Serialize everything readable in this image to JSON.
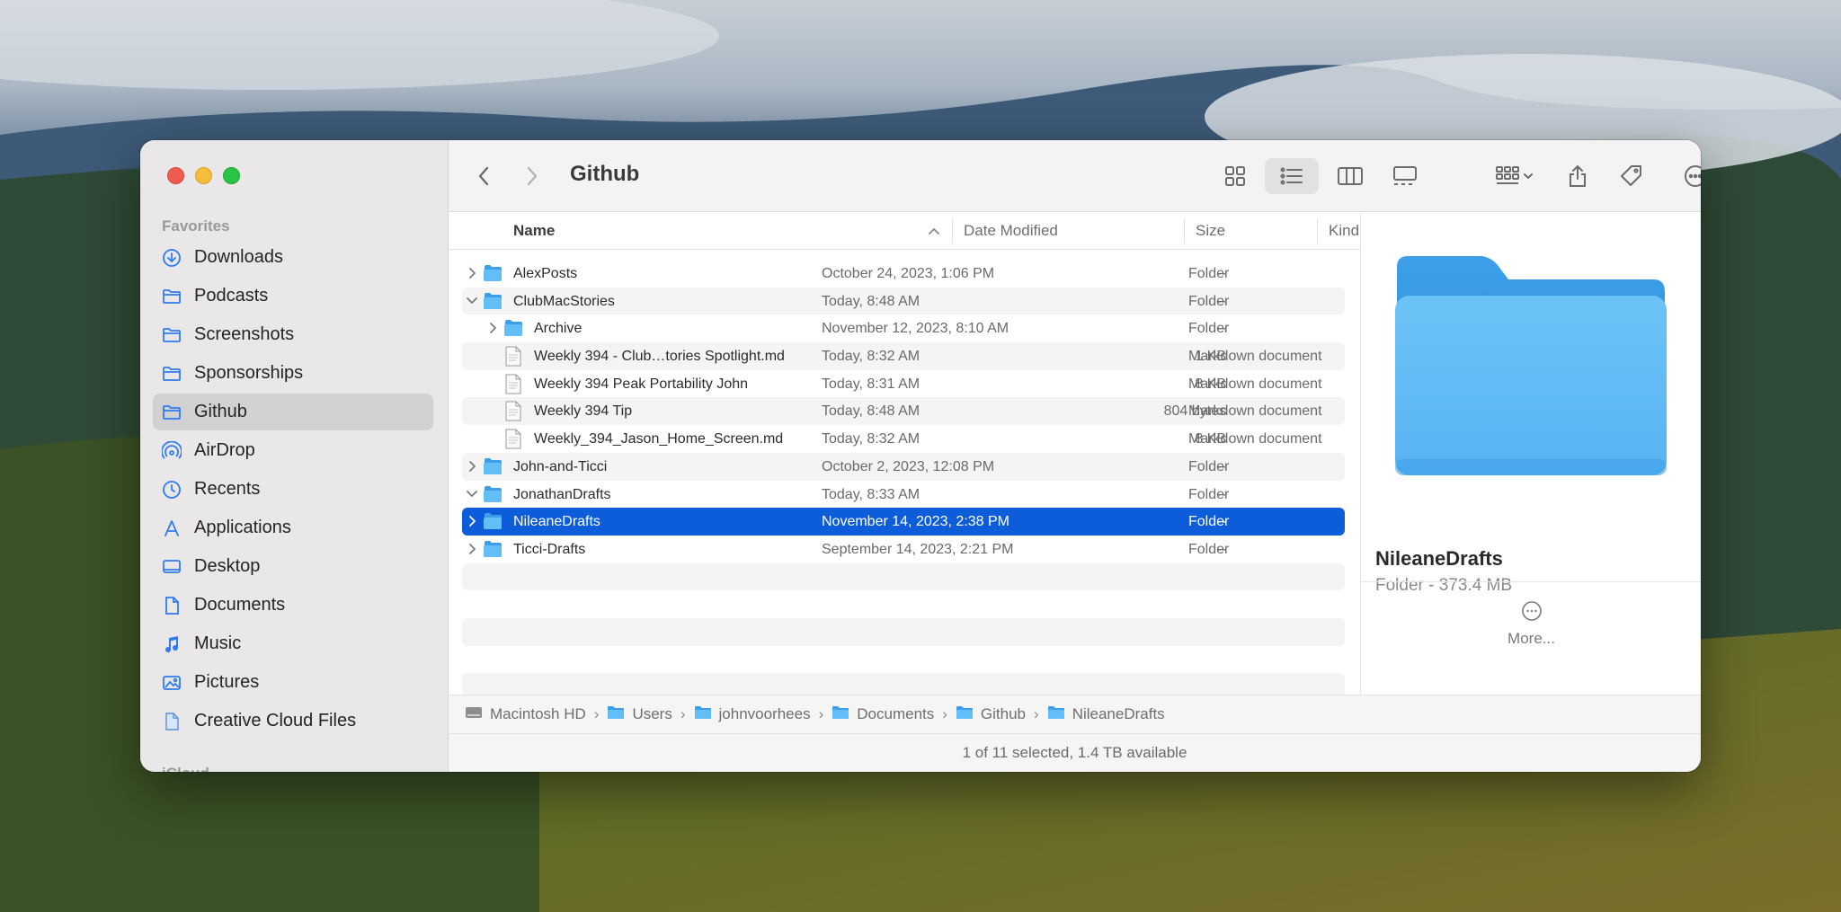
{
  "window": {
    "title": "Github"
  },
  "sidebar": {
    "section_favorites": "Favorites",
    "section_icloud": "iCloud",
    "items": [
      {
        "label": "Downloads",
        "icon": "download-icon",
        "active": false
      },
      {
        "label": "Podcasts",
        "icon": "folder-icon",
        "active": false
      },
      {
        "label": "Screenshots",
        "icon": "folder-icon",
        "active": false
      },
      {
        "label": "Sponsorships",
        "icon": "folder-icon",
        "active": false
      },
      {
        "label": "Github",
        "icon": "folder-icon",
        "active": true
      },
      {
        "label": "AirDrop",
        "icon": "airdrop-icon",
        "active": false
      },
      {
        "label": "Recents",
        "icon": "clock-icon",
        "active": false
      },
      {
        "label": "Applications",
        "icon": "applications-icon",
        "active": false
      },
      {
        "label": "Desktop",
        "icon": "desktop-icon",
        "active": false
      },
      {
        "label": "Documents",
        "icon": "document-icon",
        "active": false
      },
      {
        "label": "Music",
        "icon": "music-icon",
        "active": false
      },
      {
        "label": "Pictures",
        "icon": "pictures-icon",
        "active": false
      },
      {
        "label": "Creative Cloud Files",
        "icon": "file-icon",
        "active": false
      }
    ]
  },
  "columns": {
    "name": "Name",
    "date": "Date Modified",
    "size": "Size",
    "kind": "Kind"
  },
  "files": [
    {
      "name": "AlexPosts",
      "date": "October 24, 2023, 1:06 PM",
      "size": "--",
      "kind": "Folder",
      "type": "folder",
      "depth": 0,
      "expanded": false,
      "selected": false
    },
    {
      "name": "ClubMacStories",
      "date": "Today, 8:48 AM",
      "size": "--",
      "kind": "Folder",
      "type": "folder",
      "depth": 0,
      "expanded": true,
      "selected": false
    },
    {
      "name": "Archive",
      "date": "November 12, 2023, 8:10 AM",
      "size": "--",
      "kind": "Folder",
      "type": "folder",
      "depth": 1,
      "expanded": false,
      "selected": false
    },
    {
      "name": "Weekly 394 - Club…tories Spotlight.md",
      "date": "Today, 8:32 AM",
      "size": "1 KB",
      "kind": "Markdown document",
      "type": "doc",
      "depth": 1,
      "selected": false
    },
    {
      "name": "Weekly 394 Peak Portability John",
      "date": "Today, 8:31 AM",
      "size": "8 KB",
      "kind": "Markdown document",
      "type": "doc",
      "depth": 1,
      "selected": false
    },
    {
      "name": "Weekly 394 Tip",
      "date": "Today, 8:48 AM",
      "size": "804 bytes",
      "kind": "Markdown document",
      "type": "doc",
      "depth": 1,
      "selected": false
    },
    {
      "name": "Weekly_394_Jason_Home_Screen.md",
      "date": "Today, 8:32 AM",
      "size": "8 KB",
      "kind": "Markdown document",
      "type": "doc",
      "depth": 1,
      "selected": false
    },
    {
      "name": "John-and-Ticci",
      "date": "October 2, 2023, 12:08 PM",
      "size": "--",
      "kind": "Folder",
      "type": "folder",
      "depth": 0,
      "expanded": false,
      "selected": false
    },
    {
      "name": "JonathanDrafts",
      "date": "Today, 8:33 AM",
      "size": "--",
      "kind": "Folder",
      "type": "folder",
      "depth": 0,
      "expanded": true,
      "selected": false
    },
    {
      "name": "NileaneDrafts",
      "date": "November 14, 2023, 2:38 PM",
      "size": "--",
      "kind": "Folder",
      "type": "folder",
      "depth": 0,
      "expanded": false,
      "selected": true
    },
    {
      "name": "Ticci-Drafts",
      "date": "September 14, 2023, 2:21 PM",
      "size": "--",
      "kind": "Folder",
      "type": "folder",
      "depth": 0,
      "expanded": false,
      "selected": false
    }
  ],
  "preview": {
    "name": "NileaneDrafts",
    "subtitle": "Folder - 373.4 MB",
    "more_label": "More..."
  },
  "path": [
    "Macintosh HD",
    "Users",
    "johnvoorhees",
    "Documents",
    "Github",
    "NileaneDrafts"
  ],
  "status": "1 of 11 selected, 1.4 TB available",
  "colors": {
    "accent": "#0d5ddb",
    "folder": "#5ab8f5",
    "sidebar_icon": "#2f7bf2"
  }
}
